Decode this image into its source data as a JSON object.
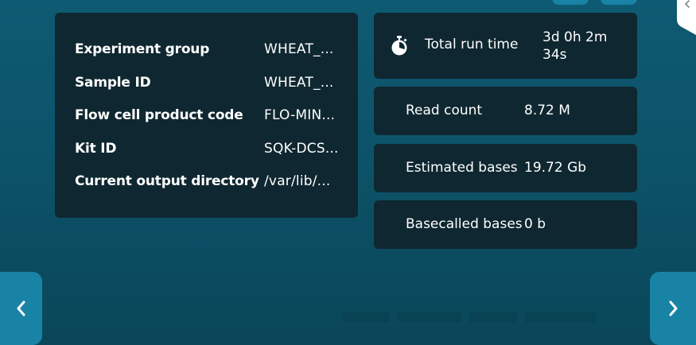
{
  "run_info": {
    "rows": [
      {
        "label": "Experiment group",
        "value": "WHEAT_..."
      },
      {
        "label": "Sample ID",
        "value": "WHEAT_..."
      },
      {
        "label": "Flow cell product code",
        "value": "FLO-MIN..."
      },
      {
        "label": "Kit ID",
        "value": "SQK-DCS..."
      },
      {
        "label": "Current output directory",
        "value": "/var/lib/..."
      }
    ]
  },
  "stats": {
    "run_time": {
      "label": "Total run time",
      "value": "3d 0h 2m 34s",
      "icon": "stopwatch-icon"
    },
    "read_count": {
      "label": "Read count",
      "value": "8.72 M"
    },
    "estimated_bases": {
      "label": "Estimated bases",
      "value": "19.72 Gb"
    },
    "basecalled_bases": {
      "label": "Basecalled bases",
      "value": "0 b"
    }
  },
  "navigation": {
    "prev_icon": "chevron-left-icon",
    "next_icon": "chevron-right-icon",
    "drawer_icon": "chevron-left-icon"
  },
  "colors": {
    "background": "#0c5369",
    "panel": "#0f2730",
    "accent": "#1983a6",
    "text": "#ffffff"
  }
}
